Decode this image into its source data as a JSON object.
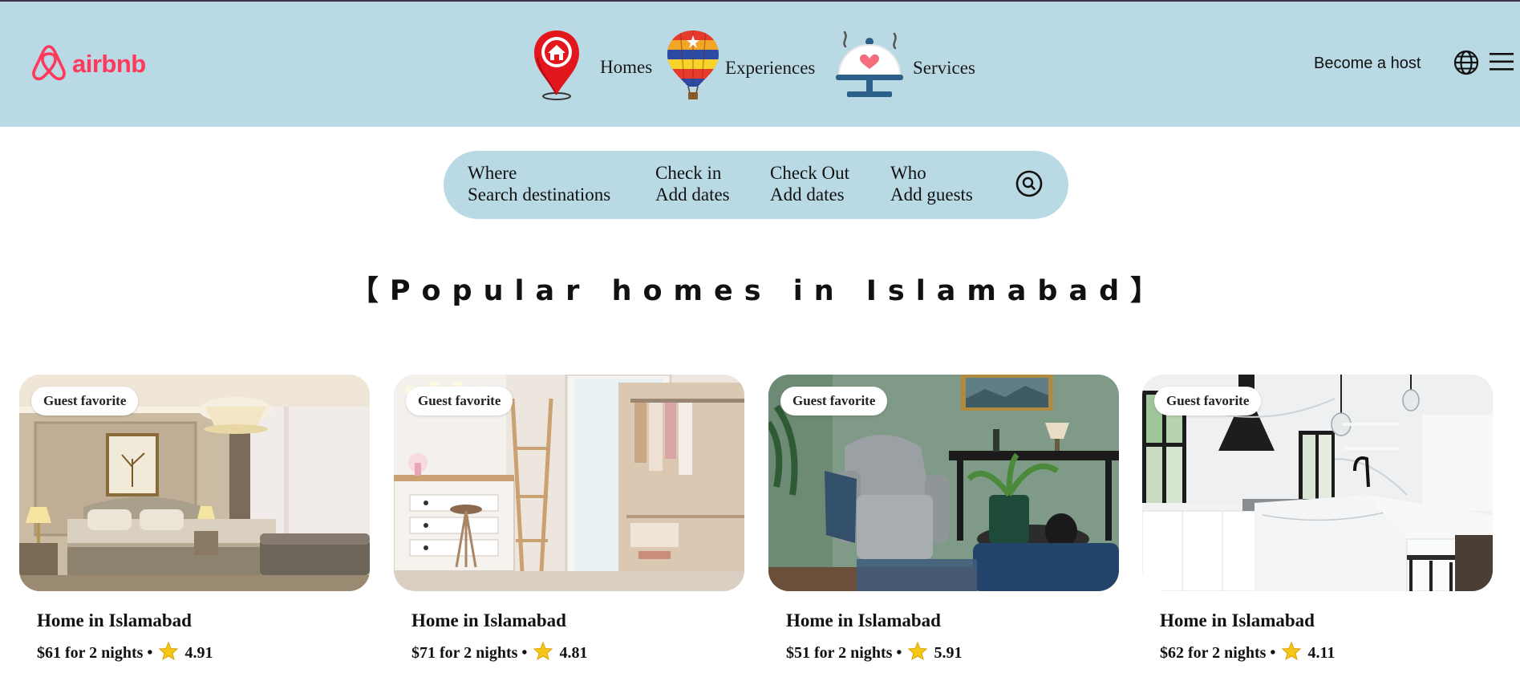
{
  "header": {
    "logo_text": "airbnb",
    "nav": [
      {
        "label": "Homes",
        "icon": "map-pin-home-icon"
      },
      {
        "label": "Experiences",
        "icon": "hot-air-balloon-icon"
      },
      {
        "label": "Services",
        "icon": "service-cloche-icon"
      }
    ],
    "become_host": "Become a host",
    "globe_icon": "globe-icon",
    "menu_icon": "hamburger-menu-icon"
  },
  "search": {
    "fields": [
      {
        "label": "Where",
        "value": "Search destinations"
      },
      {
        "label": "Check in",
        "value": "Add dates"
      },
      {
        "label": "Check Out",
        "value": "Add dates"
      },
      {
        "label": "Who",
        "value": "Add guests"
      }
    ],
    "button_icon": "search-icon"
  },
  "section": {
    "title": "【Popular homes in Islamabad】"
  },
  "listings": [
    {
      "badge": "Guest favorite",
      "title": "Home in Islamabad",
      "price": "$61 for 2 nights •",
      "rating": "4.91",
      "image": "bedroom-photo"
    },
    {
      "badge": "Guest favorite",
      "title": "Home in Islamabad",
      "price": "$71 for 2 nights •",
      "rating": "4.81",
      "image": "dressing-room-photo"
    },
    {
      "badge": "Guest favorite",
      "title": "Home in Islamabad",
      "price": "$51 for 2 nights •",
      "rating": "5.91",
      "image": "living-room-photo"
    },
    {
      "badge": "Guest favorite",
      "title": "Home in Islamabad",
      "price": "$62 for 2 nights •",
      "rating": "4.11",
      "image": "kitchen-photo"
    }
  ],
  "colors": {
    "header_bg": "#b9dae4",
    "brand": "#ff385c",
    "star": "#f5c518"
  }
}
